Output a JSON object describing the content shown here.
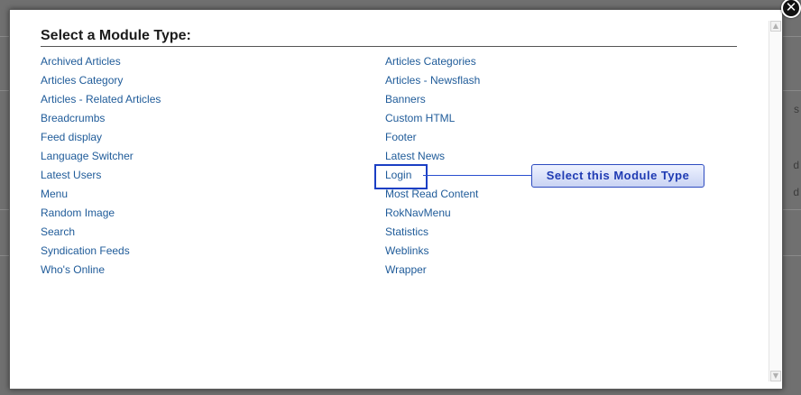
{
  "dialog": {
    "title": "Select a Module Type:",
    "close_icon": "close-icon"
  },
  "modules": {
    "left": [
      "Archived Articles",
      "Articles Category",
      "Articles - Related Articles",
      "Breadcrumbs",
      "Feed display",
      "Language Switcher",
      "Latest Users",
      "Menu",
      "Random Image",
      "Search",
      "Syndication Feeds",
      "Who's Online"
    ],
    "right": [
      "Articles Categories",
      "Articles - Newsflash",
      "Banners",
      "Custom HTML",
      "Footer",
      "Latest News",
      "Login",
      "Most Read Content",
      "RokNavMenu",
      "Statistics",
      "Weblinks",
      "Wrapper"
    ],
    "highlighted": "Login"
  },
  "annotation": {
    "label": "Select this Module Type",
    "color": "#1f3bb3"
  },
  "background_fragments": [
    "s",
    "d",
    "d"
  ],
  "colors": {
    "link": "#1f5b99",
    "overlay": "#707070"
  }
}
